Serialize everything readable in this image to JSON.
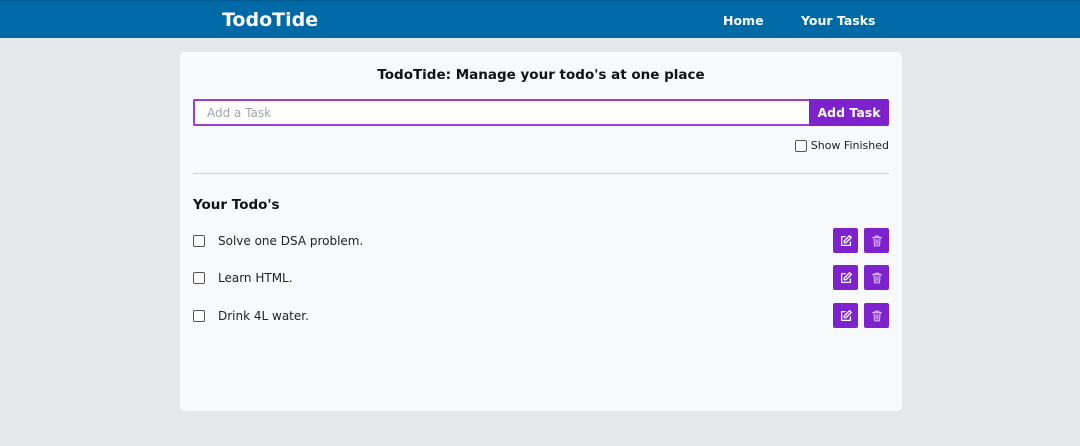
{
  "navbar": {
    "brand": "TodoTide",
    "links": [
      "Home",
      "Your Tasks"
    ]
  },
  "main": {
    "title": "TodoTide: Manage your todo's at one place",
    "input_placeholder": "Add a Task",
    "input_value": "",
    "add_button_label": "Add Task",
    "show_finished_label": "Show Finished",
    "show_finished_checked": false,
    "section_title": "Your Todo's",
    "todos": [
      {
        "text": "Solve one DSA problem.",
        "done": false
      },
      {
        "text": "Learn HTML.",
        "done": false
      },
      {
        "text": "Drink 4L water.",
        "done": false
      }
    ],
    "icons": {
      "edit": "edit-icon",
      "delete": "trash-icon"
    }
  },
  "colors": {
    "navbar": "#006aa6",
    "accent": "#7e22ce",
    "input_border": "#9a3fd0",
    "background": "#e5e7eb",
    "card": "#f8f9fb"
  }
}
